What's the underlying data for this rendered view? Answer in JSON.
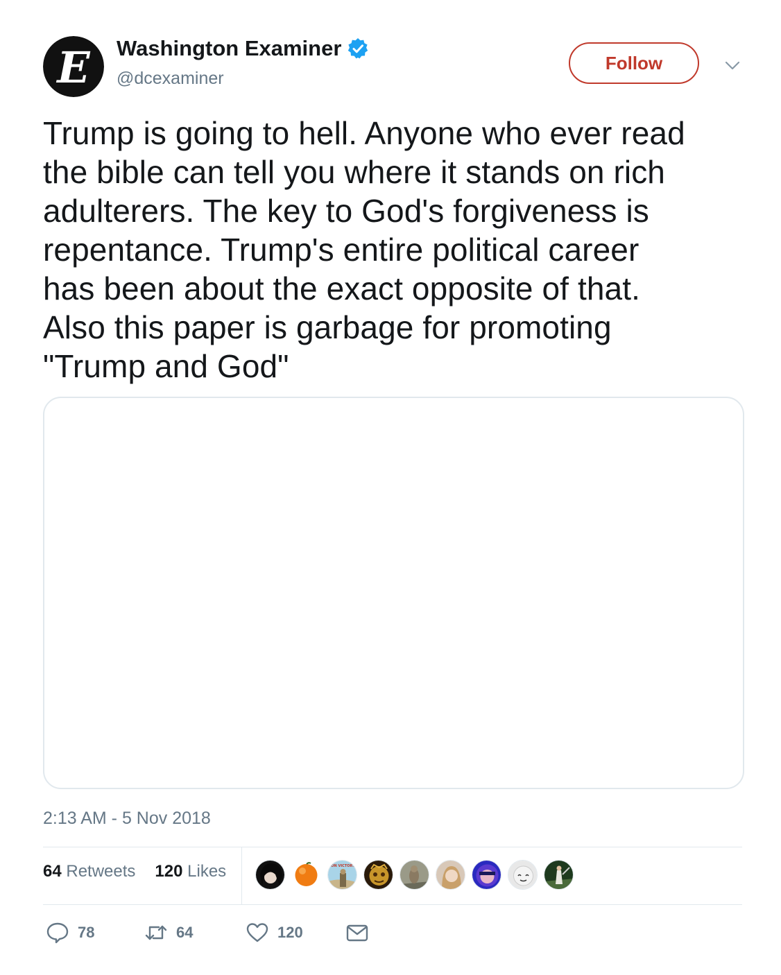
{
  "header": {
    "display_name": "Washington Examiner",
    "handle": "@dcexaminer",
    "follow_label": "Follow",
    "avatar_letter": "E"
  },
  "tweet": {
    "text": "Trump is going to hell. Anyone who ever read\nthe bible can tell you where it stands on rich\nadulterers. The key to God's forgiveness is\nrepentance. Trump's entire political career\nhas been about the exact opposite of that.\nAlso this paper is garbage for promoting\n\"Trump and God\"",
    "timestamp": "2:13 AM - 5 Nov 2018"
  },
  "stats": {
    "retweets_count": "64",
    "retweets_label": "Retweets",
    "likes_count": "120",
    "likes_label": "Likes"
  },
  "actions": {
    "replies": "78",
    "retweets": "64",
    "likes": "120"
  },
  "likers_avatar_text": {
    "victory": "ON VICTORY"
  },
  "colors": {
    "follow_accent": "#c0392b",
    "verified_blue": "#1da1f2",
    "muted_text": "#657786",
    "border": "#e1e8ed"
  }
}
